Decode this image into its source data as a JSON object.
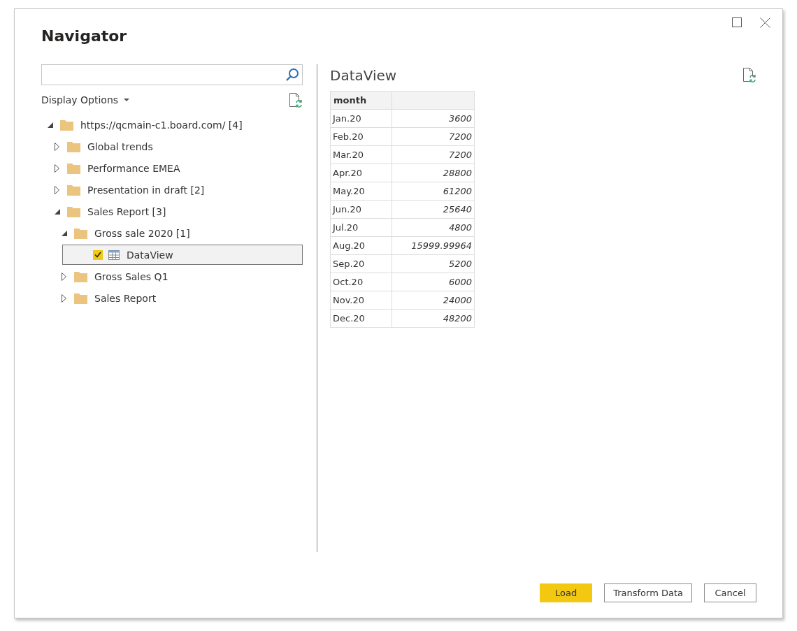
{
  "window": {
    "title": "Navigator"
  },
  "display_options": {
    "label": "Display Options"
  },
  "tree": [
    {
      "label": "https://qcmain-c1.board.com/ [4]",
      "kind": "folder",
      "expanded": true,
      "selected": false,
      "children": [
        {
          "label": "Global trends",
          "kind": "folder",
          "expanded": false,
          "selected": false
        },
        {
          "label": "Performance EMEA",
          "kind": "folder",
          "expanded": false,
          "selected": false
        },
        {
          "label": "Presentation in draft [2]",
          "kind": "folder",
          "expanded": false,
          "selected": false
        },
        {
          "label": "Sales Report [3]",
          "kind": "folder",
          "expanded": true,
          "selected": false,
          "children": [
            {
              "label": "Gross sale 2020 [1]",
              "kind": "folder",
              "expanded": true,
              "selected": false,
              "children": [
                {
                  "label": "DataView",
                  "kind": "table",
                  "checked": true,
                  "selected": true
                }
              ]
            },
            {
              "label": "Gross Sales Q1",
              "kind": "folder",
              "expanded": false,
              "selected": false
            },
            {
              "label": "Sales Report",
              "kind": "folder",
              "expanded": false,
              "selected": false
            }
          ]
        }
      ]
    }
  ],
  "preview": {
    "title": "DataView",
    "columns": [
      "month"
    ],
    "rows": [
      {
        "month": "Jan.20",
        "column_2": "3600"
      },
      {
        "month": "Feb.20",
        "column_2": "7200"
      },
      {
        "month": "Mar.20",
        "column_2": "7200"
      },
      {
        "month": "Apr.20",
        "column_2": "28800"
      },
      {
        "month": "May.20",
        "column_2": "61200"
      },
      {
        "month": "Jun.20",
        "column_2": "25640"
      },
      {
        "month": "Jul.20",
        "column_2": "4800"
      },
      {
        "month": "Aug.20",
        "column_2": "15999.99964"
      },
      {
        "month": "Sep.20",
        "column_2": "5200"
      },
      {
        "month": "Oct.20",
        "column_2": "6000"
      },
      {
        "month": "Nov.20",
        "column_2": "24000"
      },
      {
        "month": "Dec.20",
        "column_2": "48200"
      }
    ]
  },
  "buttons": [
    {
      "label": "Load",
      "kind": "primary"
    },
    {
      "label": "Transform Data",
      "kind": "secondary"
    },
    {
      "label": "Cancel",
      "kind": "secondary"
    }
  ]
}
